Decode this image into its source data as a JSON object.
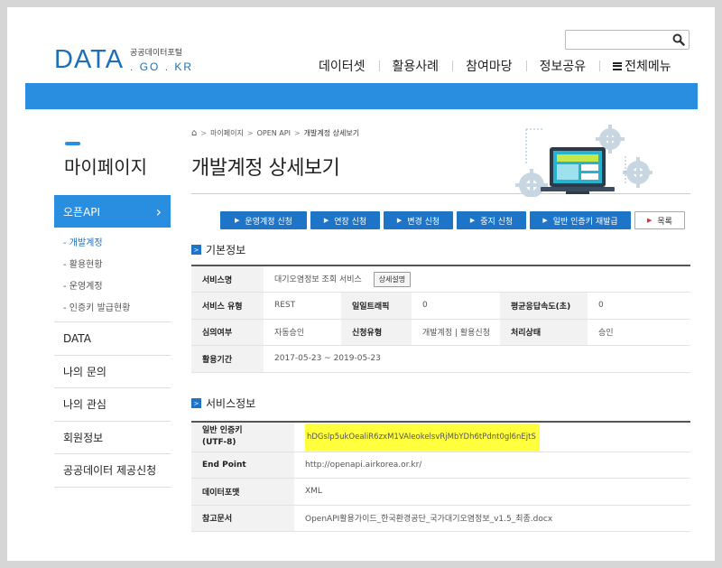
{
  "header": {
    "logo_main": "DATA",
    "logo_korean": "공공데이터포털",
    "logo_domain": ". GO . KR",
    "search": {
      "placeholder": "",
      "value": ""
    },
    "nav": [
      "데이터셋",
      "활용사례",
      "참여마당",
      "정보공유"
    ],
    "all_menu": "전체메뉴"
  },
  "sidebar": {
    "title": "마이페이지",
    "active_item": "오픈API",
    "active_chevron": "›",
    "sub_items": [
      "- 개발계정",
      "- 활용현황",
      "- 운영계정",
      "- 인증키 발급현황"
    ],
    "items": [
      "DATA",
      "나의 문의",
      "나의 관심",
      "회원정보",
      "공공데이터 제공신청"
    ]
  },
  "breadcrumb": {
    "home_icon": "⌂",
    "sep": ">",
    "items": [
      "마이페이지",
      "OPEN API",
      "개발계정 상세보기"
    ]
  },
  "page_title": "개발계정 상세보기",
  "buttons": {
    "marker": "▶",
    "items": [
      "운영계정 신청",
      "연장 신청",
      "변경 신청",
      "중지 신청",
      "일반 인증키 재발급"
    ],
    "list_label": "목록"
  },
  "basic_info": {
    "title": "기본정보",
    "icon": ">",
    "service_name_label": "서비스명",
    "service_name": "대기오염정보 조회 서비스",
    "detail_button": "상세설명",
    "service_type_label": "서비스 유형",
    "service_type": "REST",
    "daily_traffic_label": "일일트래픽",
    "daily_traffic": "0",
    "avg_response_label": "평균응답속도(초)",
    "avg_response": "0",
    "approval_label": "심의여부",
    "approval": "자동승인",
    "apply_type_label": "신청유형",
    "apply_type": "개발계정 | 활용신청",
    "status_label": "처리상태",
    "status": "승인",
    "period_label": "활용기간",
    "period": "2017-05-23 ~ 2019-05-23"
  },
  "service_info": {
    "title": "서비스정보",
    "icon": ">",
    "key_label_line1": "일반 인증키",
    "key_label_line2": "(UTF-8)",
    "key_value": "hDGslp5ukOealiR6zxM1VAleokelsvRjMbYDh6tPdnt0gl6nEjtS",
    "endpoint_label": "End Point",
    "endpoint": "http://openapi.airkorea.or.kr/",
    "format_label": "데이터포맷",
    "format": "XML",
    "doc_label": "참고문서",
    "doc": "OpenAPI활용가이드_한국환경공단_국가대기오염정보_v1.5_최종.docx"
  },
  "colors": {
    "brand_blue": "#2a8ee0",
    "button_blue": "#1e74c6",
    "highlight": "#ffff3d"
  }
}
